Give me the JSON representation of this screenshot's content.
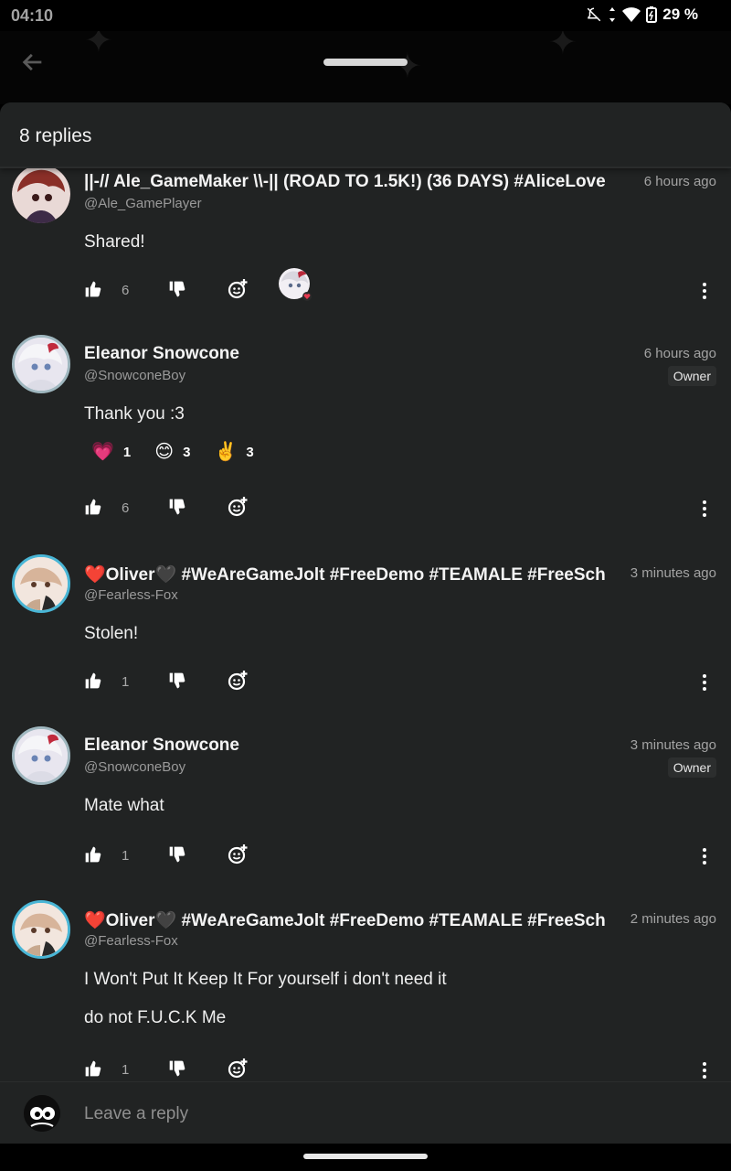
{
  "status_bar": {
    "time": "04:10",
    "battery": "29 %"
  },
  "sheet": {
    "title": "8 replies"
  },
  "comments": [
    {
      "name": "||-// Ale_GameMaker \\\\-|| (ROAD TO 1.5K!) (36 DAYS) #AliceLove",
      "handle": "@Ale_GamePlayer",
      "time": "6 hours ago",
      "text": "Shared!",
      "likes": "6"
    },
    {
      "name": "Eleanor Snowcone",
      "handle": "@SnowconeBoy",
      "time": "6 hours ago",
      "badge": "Owner",
      "text": "Thank you :3",
      "reactions": [
        {
          "emoji": "💗",
          "count": "1"
        },
        {
          "emoji": "😊",
          "count": "3"
        },
        {
          "emoji": "✌️",
          "count": "3"
        }
      ],
      "likes": "6"
    },
    {
      "name": "❤️Oliver🖤 #WeAreGameJolt #FreeDemo #TEAMALE #FreeSch",
      "handle": "@Fearless-Fox",
      "time": "3 minutes ago",
      "text": "Stolen!",
      "likes": "1"
    },
    {
      "name": "Eleanor Snowcone",
      "handle": "@SnowconeBoy",
      "time": "3 minutes ago",
      "badge": "Owner",
      "text": "Mate what",
      "likes": "1"
    },
    {
      "name": "❤️Oliver🖤 #WeAreGameJolt #FreeDemo #TEAMALE #FreeSch",
      "handle": "@Fearless-Fox",
      "time": "2 minutes ago",
      "text": "I Won't Put It Keep It For yourself i don't need it",
      "text2": "do not F.U.C.K Me",
      "likes": "1"
    }
  ],
  "reply_input": {
    "placeholder": "Leave a reply"
  }
}
